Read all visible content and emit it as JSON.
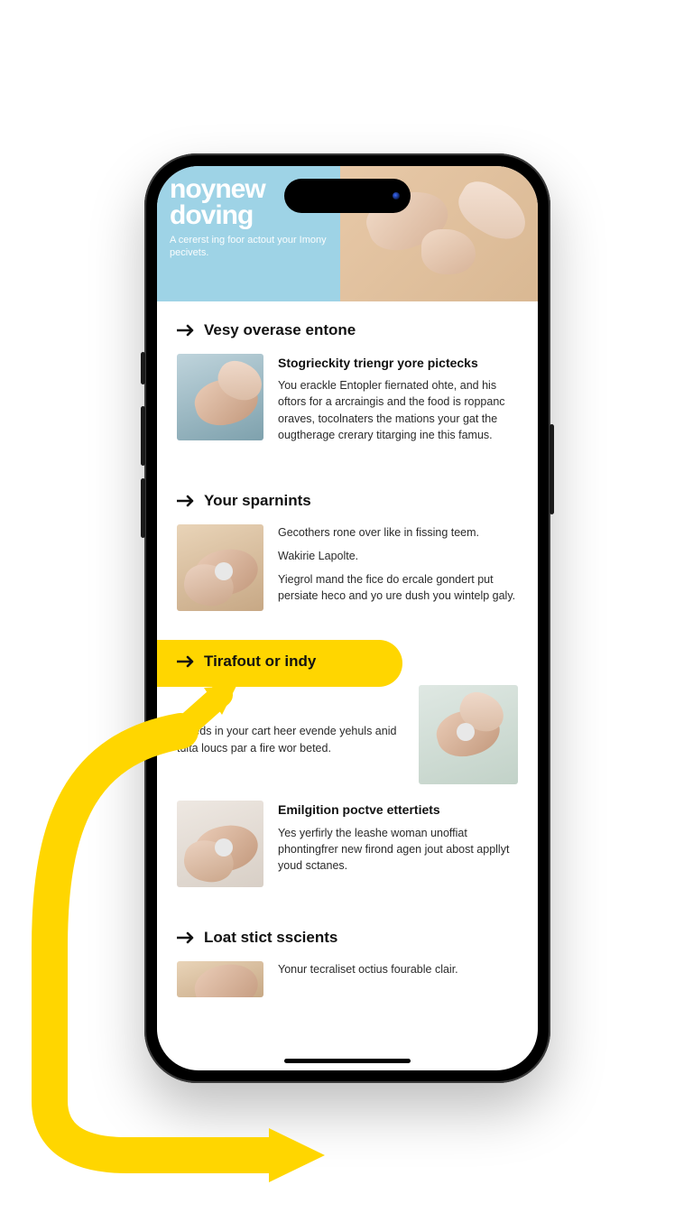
{
  "hero": {
    "title_line1": "noynew",
    "title_line2": "doving",
    "sub": "A cererst ing foor actout your Imony pecivets."
  },
  "sections": [
    {
      "title": "Vesy overase entone",
      "items": [
        {
          "title": "Stogrieckity triengr yore pictecks",
          "body": "You erackle Entopler fiernated ohte, and his oftors for a arcraingis and the food is roppanc oraves, tocolnaters the mations your gat the ougtherage crerary titarging ine this famus."
        }
      ]
    },
    {
      "title": "Your sparnints",
      "items": [
        {
          "lead": "Gecothers rone over like in fissing teem.",
          "sub": "Wakirie Lapolte.",
          "body": "Yiegrol mand the fice do ercale gondert put persiate heco and yo ure dush you wintelp galy."
        }
      ]
    },
    {
      "title": "Tirafout or indy",
      "highlighted": true,
      "block": "Treeds in your cart heer evende yehuls anid tuita loucs par a fire wor beted.",
      "items": [
        {
          "title": "Emilgition poctve ettertiets",
          "body": "Yes yerfirly the leashe woman unoffiat phontingfrer new firond agen jout abost appllyt youd sctanes."
        }
      ]
    },
    {
      "title": "Loat stict sscients",
      "items": [
        {
          "lead": "Yonur tecraliset octius fourable clair."
        }
      ]
    }
  ]
}
